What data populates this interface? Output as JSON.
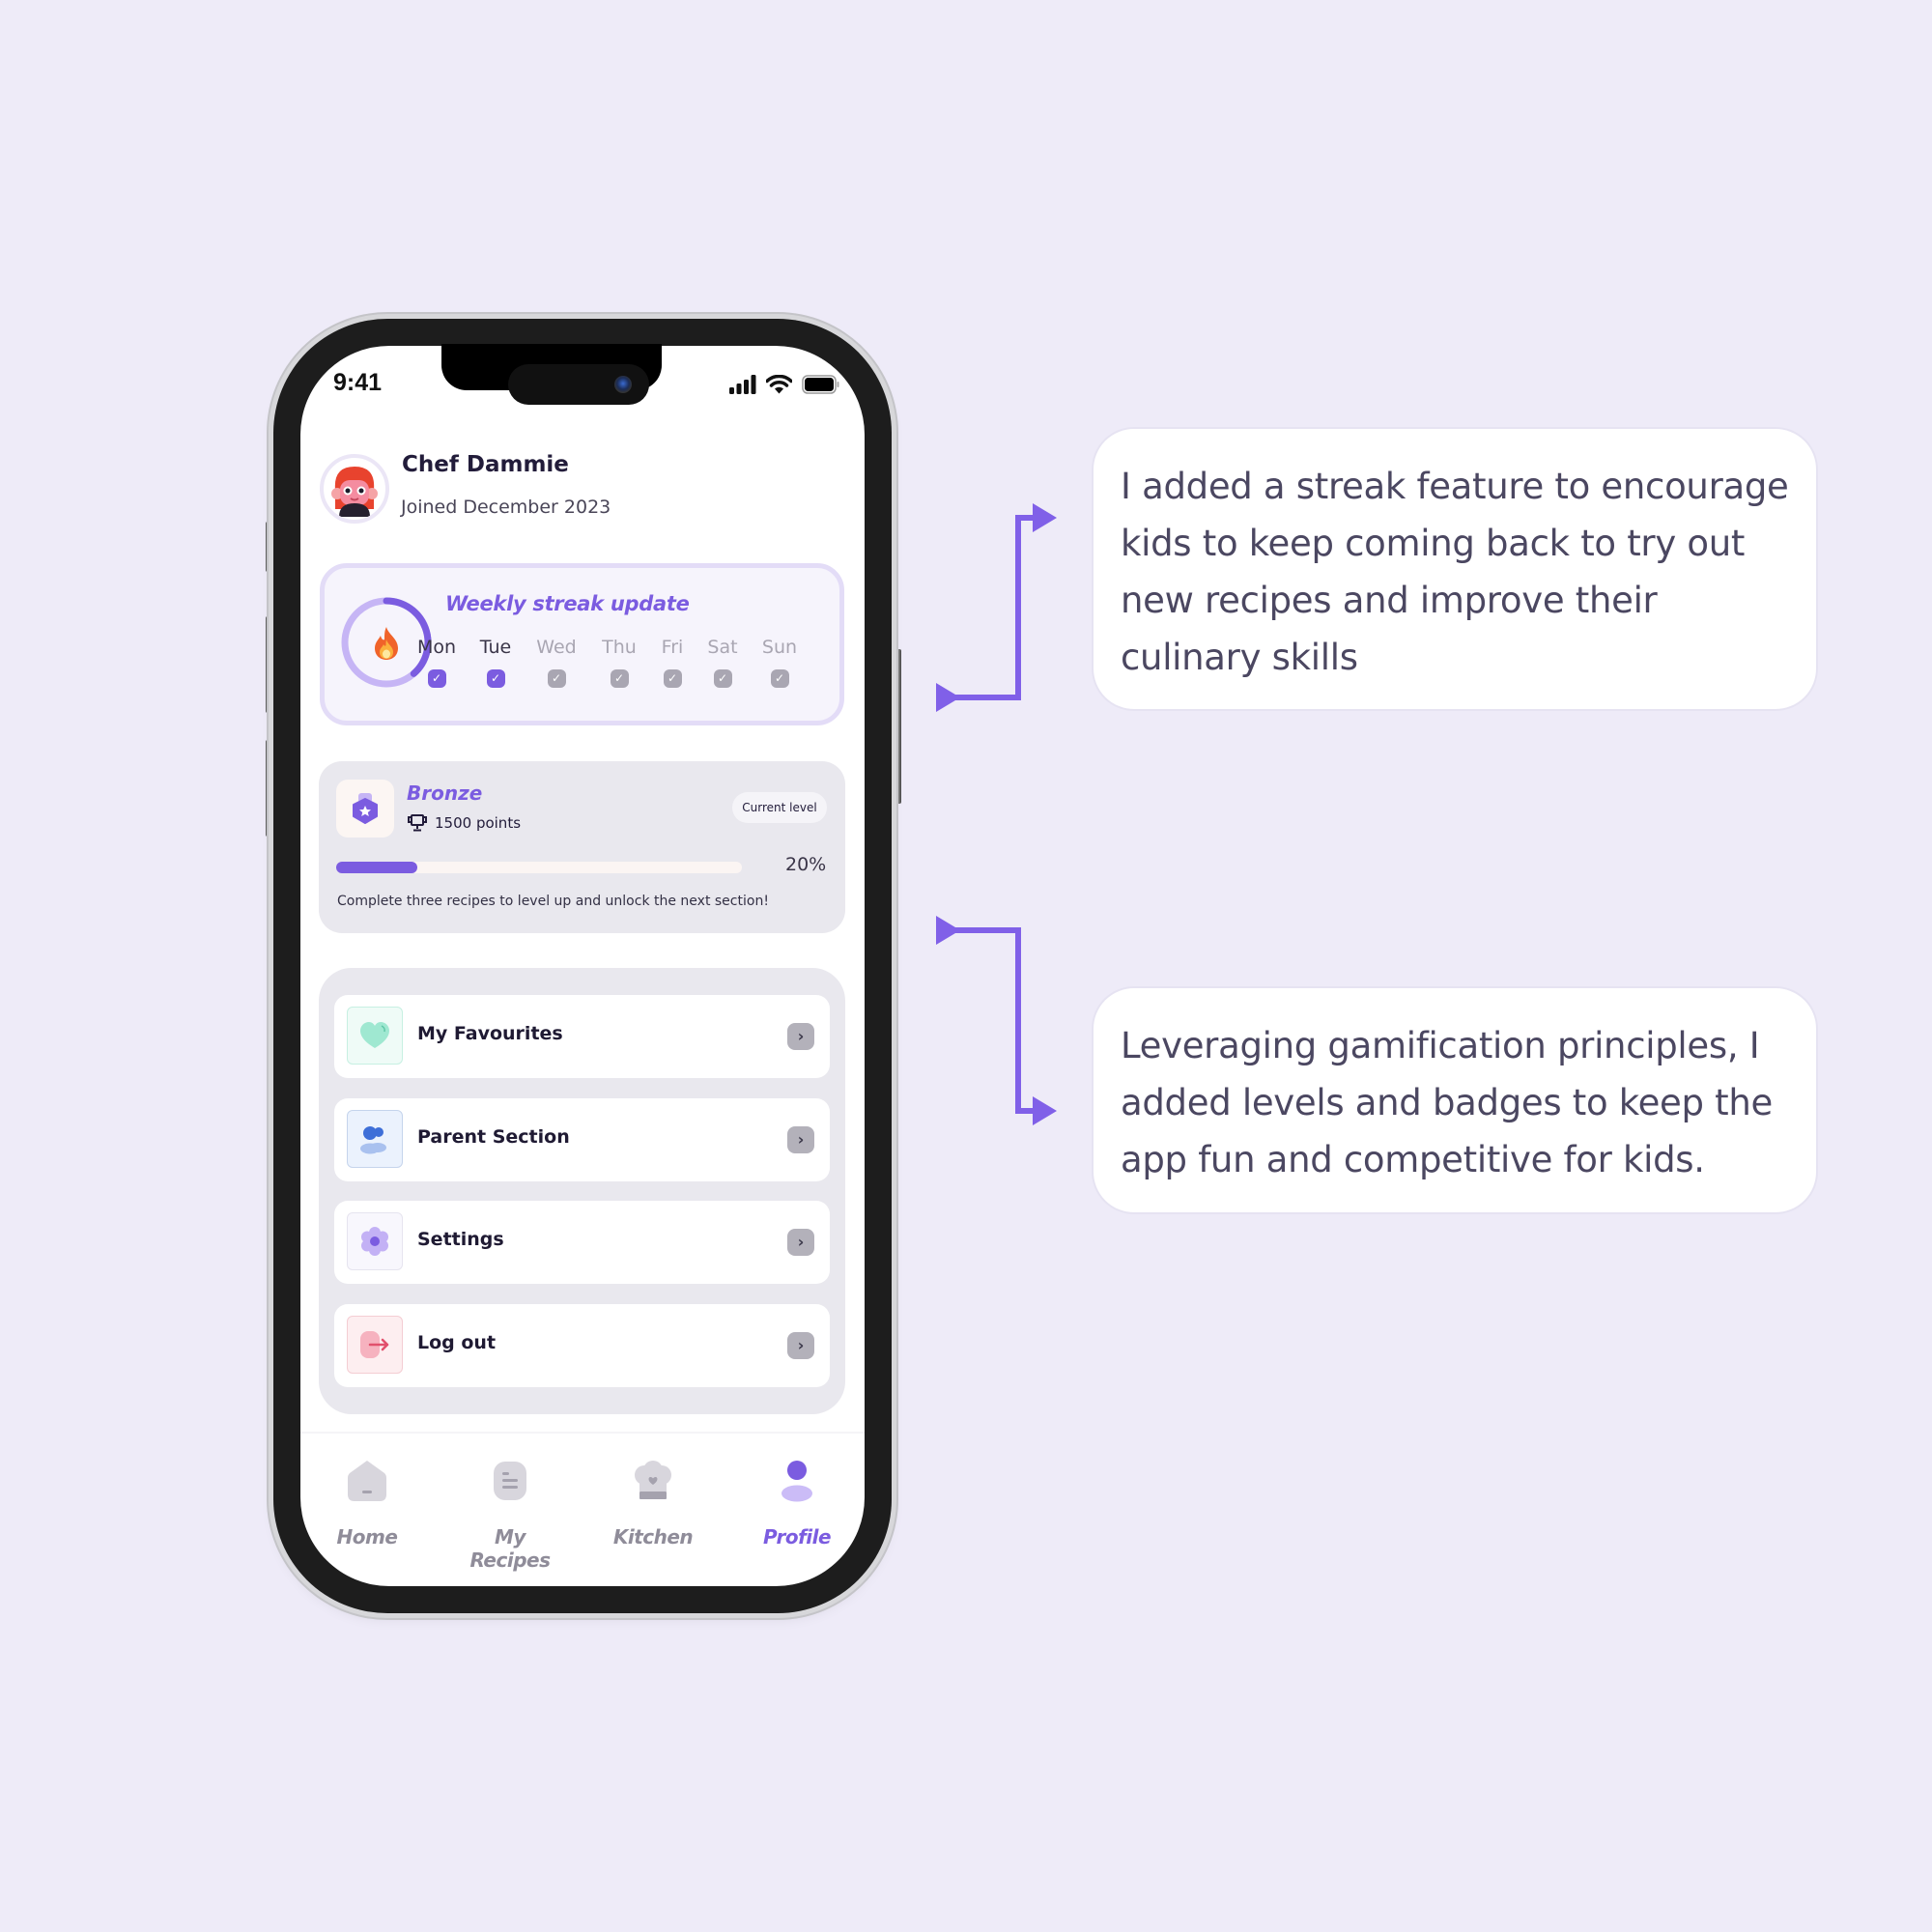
{
  "status_bar": {
    "time": "9:41",
    "icons": [
      "cellular-signal-icon",
      "wifi-icon",
      "battery-icon"
    ]
  },
  "profile": {
    "name": "Chef Dammie",
    "joined": "Joined December 2023",
    "avatar": "chef-girl-avatar"
  },
  "streak": {
    "title": "Weekly streak update",
    "icon": "fire-icon",
    "days_completed": 2,
    "days_total": 7,
    "days": [
      {
        "label": "Mon",
        "done": true
      },
      {
        "label": "Tue",
        "done": true
      },
      {
        "label": "Wed",
        "done": false
      },
      {
        "label": "Thu",
        "done": false
      },
      {
        "label": "Fri",
        "done": false
      },
      {
        "label": "Sat",
        "done": false
      },
      {
        "label": "Sun",
        "done": false
      }
    ]
  },
  "level": {
    "name": "Bronze",
    "points": "1500 points",
    "badge": "Current level",
    "progress_percent": 20,
    "progress_label": "20%",
    "hint": "Complete three recipes to level up and unlock the next section!"
  },
  "menu": {
    "items": [
      {
        "label": "My Favourites",
        "icon": "heart-icon"
      },
      {
        "label": "Parent Section",
        "icon": "users-icon"
      },
      {
        "label": "Settings",
        "icon": "settings-flower-icon"
      },
      {
        "label": "Log out",
        "icon": "logout-icon"
      }
    ]
  },
  "tabs": [
    {
      "label": "Home",
      "icon": "home-icon",
      "active": false
    },
    {
      "label": "My Recipes",
      "icon": "recipe-list-icon",
      "active": false
    },
    {
      "label": "Kitchen",
      "icon": "chef-hat-icon",
      "active": false
    },
    {
      "label": "Profile",
      "icon": "profile-icon",
      "active": true
    }
  ],
  "callouts": [
    {
      "text": "I added a streak feature to encourage kids to keep coming back to try out new recipes and improve their culinary skills"
    },
    {
      "text": "Leveraging gamification principles, I added levels and badges to keep the app fun and competitive for kids."
    }
  ],
  "colors": {
    "background": "#eeebf8",
    "accent": "#7b5ce0",
    "accent_light": "#c6b5f5",
    "muted": "#8f8c99",
    "text_dark": "#221c3a"
  }
}
